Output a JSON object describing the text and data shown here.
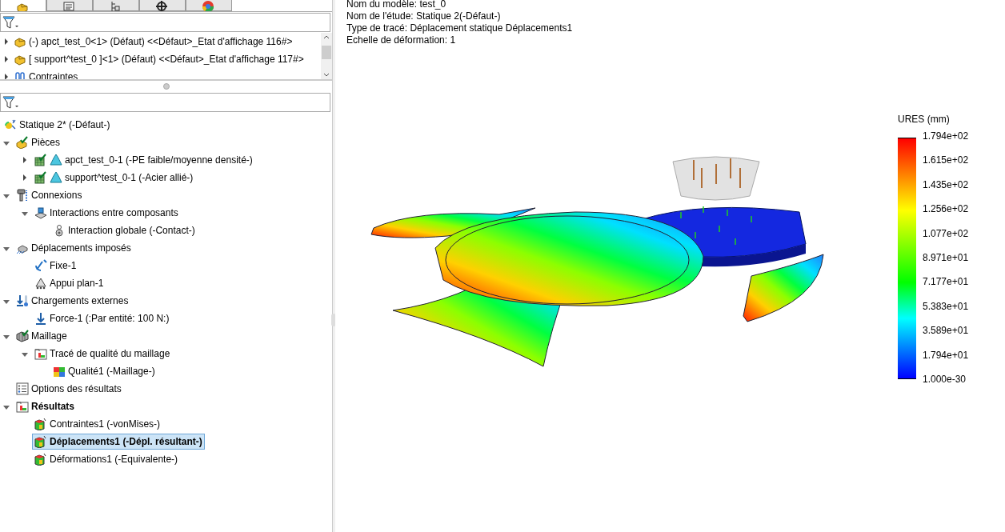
{
  "panel_tabs": [
    {
      "kind": "part",
      "selected": true
    },
    {
      "kind": "list",
      "selected": false
    },
    {
      "kind": "config",
      "selected": false
    },
    {
      "kind": "target",
      "selected": false
    },
    {
      "kind": "display",
      "selected": false
    }
  ],
  "feature_tree": [
    {
      "label": "(-) apct_test_0<1> (Défaut) <<Défaut>_Etat d'affichage 116#>",
      "kind": "assembly-part",
      "expanded": false
    },
    {
      "label": "[ support^test_0 ]<1> (Défaut) <<Défaut>_Etat d'affichage 117#>",
      "kind": "assembly-part",
      "expanded": false
    },
    {
      "label": "Contraintes",
      "kind": "mates",
      "expanded": false
    }
  ],
  "study_tree": [
    {
      "label": "Statique 2* (-Défaut-)",
      "kind": "study",
      "bold": false,
      "selected": false,
      "children": [
        {
          "label": "Pièces",
          "kind": "parts",
          "expanded": true,
          "bold": false,
          "selected": false,
          "children": [
            {
              "label": "apct_test_0-1 (-PE faible/moyenne densité-)",
              "kind": "mesh-part",
              "expanded": false,
              "bold": false,
              "selected": false
            },
            {
              "label": "support^test_0-1 (-Acier allié-)",
              "kind": "mesh-part",
              "expanded": false,
              "bold": false,
              "selected": false
            }
          ]
        },
        {
          "label": "Connexions",
          "kind": "connections",
          "expanded": true,
          "bold": false,
          "selected": false,
          "children": [
            {
              "label": "Interactions entre composants",
              "kind": "interactions",
              "expanded": true,
              "bold": false,
              "selected": false,
              "children": [
                {
                  "label": "Interaction globale (-Contact-)",
                  "kind": "contact",
                  "bold": false,
                  "selected": false
                }
              ]
            }
          ]
        },
        {
          "label": "Déplacements imposés",
          "kind": "fixtures",
          "expanded": true,
          "bold": false,
          "selected": false,
          "children": [
            {
              "label": "Fixe-1",
              "kind": "fixed",
              "bold": false,
              "selected": false
            },
            {
              "label": "Appui plan-1",
              "kind": "roller",
              "bold": false,
              "selected": false
            }
          ]
        },
        {
          "label": "Chargements externes",
          "kind": "loads",
          "expanded": true,
          "bold": false,
          "selected": false,
          "children": [
            {
              "label": "Force-1 (:Par entité: 100 N:)",
              "kind": "force",
              "bold": false,
              "selected": false
            }
          ]
        },
        {
          "label": "Maillage",
          "kind": "mesh",
          "expanded": true,
          "bold": false,
          "selected": false,
          "children": [
            {
              "label": "Tracé de qualité du maillage",
              "kind": "plot-folder",
              "expanded": true,
              "bold": false,
              "selected": false,
              "children": [
                {
                  "label": "Qualité1 (-Maillage-)",
                  "kind": "quality",
                  "bold": false,
                  "selected": false
                }
              ]
            }
          ]
        },
        {
          "label": "Options des résultats",
          "kind": "options",
          "bold": false,
          "selected": false
        },
        {
          "label": "Résultats",
          "kind": "plot-folder",
          "expanded": true,
          "bold": true,
          "selected": false,
          "children": [
            {
              "label": "Contraintes1 (-vonMises-)",
              "kind": "result-plot",
              "bold": false,
              "selected": false
            },
            {
              "label": "Déplacements1 (-Dépl. résultant-)",
              "kind": "result-plot",
              "bold": true,
              "selected": true
            },
            {
              "label": "Déformations1 (-Equivalente-)",
              "kind": "result-plot",
              "bold": false,
              "selected": false
            }
          ]
        }
      ]
    }
  ],
  "plot_info": [
    "Nom du modèle: test_0",
    "Nom de l'étude: Statique 2(-Défaut-)",
    "Type de tracé: Déplacement statique Déplacements1",
    "Echelle de déformation: 1"
  ],
  "legend": {
    "title": "URES (mm)",
    "ticks": [
      "1.794e+02",
      "1.615e+02",
      "1.435e+02",
      "1.256e+02",
      "1.077e+02",
      "8.971e+01",
      "7.177e+01",
      "5.383e+01",
      "3.589e+01",
      "1.794e+01",
      "1.000e-30"
    ]
  }
}
